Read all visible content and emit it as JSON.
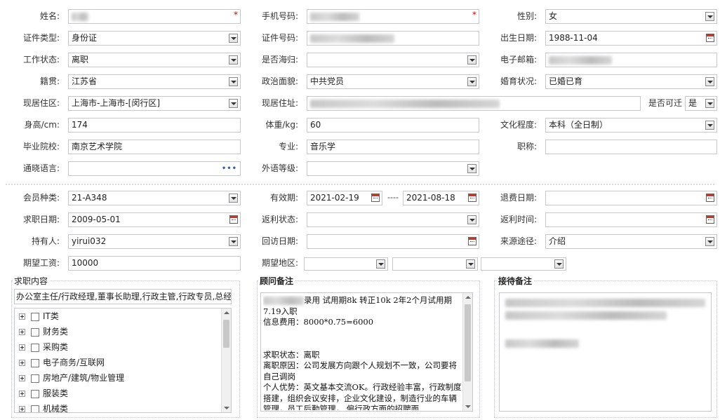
{
  "form": {
    "name_label": "姓名:",
    "phone_label": "手机号码:",
    "gender_label": "性别:",
    "gender_value": "女",
    "id_type_label": "证件类型:",
    "id_type_value": "身份证",
    "id_no_label": "证件号码:",
    "birth_label": "出生日期:",
    "birth_value": "1988-11-04",
    "work_status_label": "工作状态:",
    "work_status_value": "离职",
    "returnee_label": "是否海归:",
    "email_label": "电子邮箱:",
    "hometown_label": "籍贯:",
    "hometown_value": "江苏省",
    "politics_label": "政治面貌:",
    "politics_value": "中共党员",
    "marital_label": "婚育状况:",
    "marital_value": "已婚已育",
    "district_label": "现居住区:",
    "district_value": "上海市-上海市-[闵行区]",
    "address_label": "现居住址:",
    "relocate_label": "是否可迁",
    "relocate_value": "是",
    "height_label": "身高/cm:",
    "height_value": "174",
    "weight_label": "体重/kg:",
    "weight_value": "60",
    "education_label": "文化程度:",
    "education_value": "本科（全日制）",
    "school_label": "毕业院校:",
    "school_value": "南京艺术学院",
    "major_label": "专业:",
    "major_value": "音乐学",
    "title_label": "职称:",
    "language_label": "通晓语言:",
    "language_more": "•••",
    "foreign_level_label": "外语等级:"
  },
  "member": {
    "type_label": "会员种类:",
    "type_value": "21-A348",
    "valid_label": "有效期:",
    "valid_from": "2021-02-19",
    "valid_sep": "----",
    "valid_to": "2021-08-18",
    "refund_date_label": "退费日期:",
    "job_date_label": "求职日期:",
    "job_date_value": "2009-05-01",
    "rebate_status_label": "返利状态:",
    "rebate_time_label": "返利时间:",
    "holder_label": "持有人:",
    "holder_value": "yirui032",
    "visit_date_label": "回访日期:",
    "source_label": "来源途径:",
    "source_value": "介绍",
    "salary_label": "期望工资:",
    "salary_value": "10000",
    "region_label": "期望地区:"
  },
  "job_content": {
    "title": "求职内容",
    "selected_text": "办公室主任/行政经理,董事长助理,行政主管,行政专员,总经",
    "tree": [
      "IT类",
      "财务类",
      "采购类",
      "电子商务/互联网",
      "房地产/建筑/物业管理",
      "服装类",
      "机械类"
    ]
  },
  "consultant_notes": {
    "title": "顾问备注",
    "line1": "录用 试用期8k 转正10k 2年2个月试用期",
    "line2": "7.19入职",
    "line3": "信息费用：8000*0.75=6000",
    "line4": "求职状态：离职",
    "line5": "离职原因：公司发展方向跟个人规划不一致，公司要将自己调岗",
    "line6": "个人优势：英文基本交流OK。行政经验丰富，行政制度搭建，组织会议安排，企业文化建设，制造行业的车辆管理，员工后勤管理， 偏行政方面的招聘面"
  },
  "reception_notes": {
    "title": "接待备注"
  }
}
